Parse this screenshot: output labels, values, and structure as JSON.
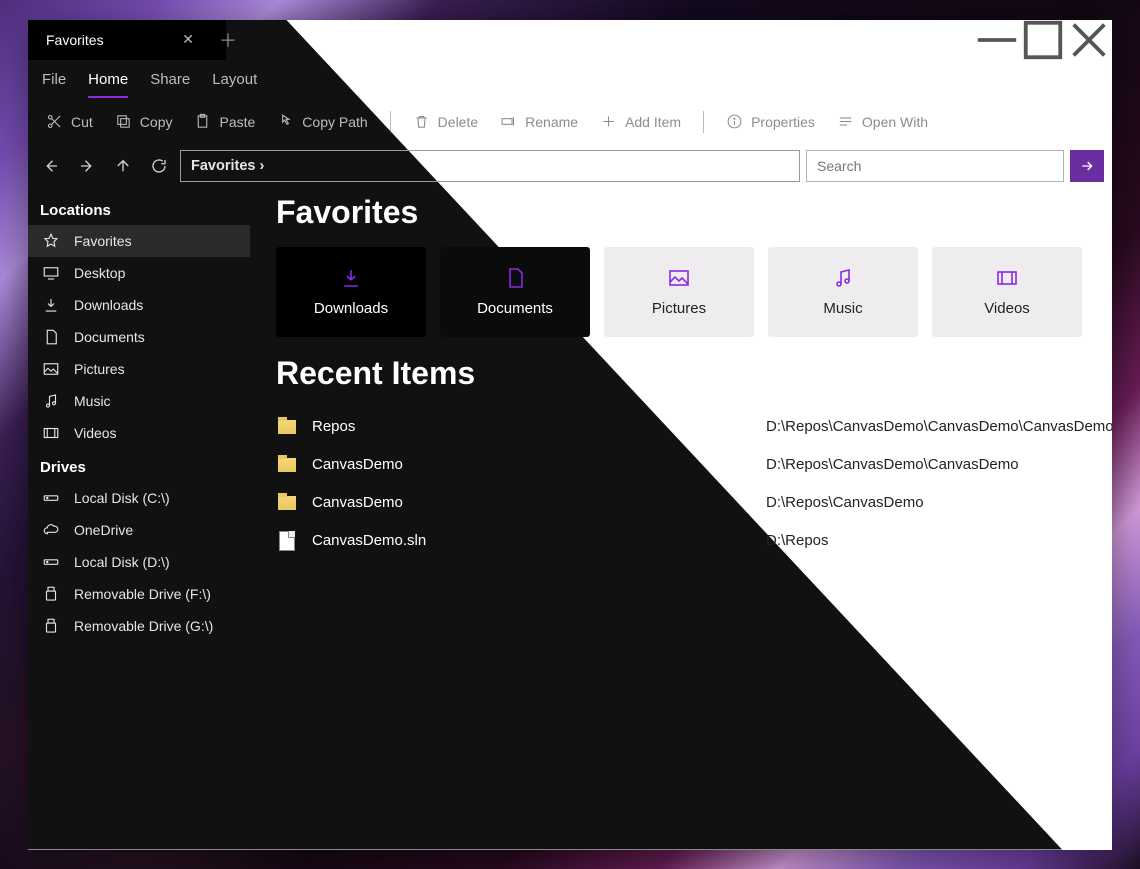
{
  "titlebar": {
    "tab_title": "Favorites"
  },
  "ribbon_tabs": [
    "File",
    "Home",
    "Share",
    "Layout"
  ],
  "ribbon_active": 1,
  "toolbar": {
    "cut": "Cut",
    "copy": "Copy",
    "paste": "Paste",
    "copy_path": "Copy Path",
    "delete": "Delete",
    "rename": "Rename",
    "add_item": "Add Item",
    "properties": "Properties",
    "open_with": "Open With"
  },
  "address": "Favorites ›",
  "search_placeholder": "Search",
  "sidebar": {
    "locations_heading": "Locations",
    "locations": [
      {
        "icon": "star",
        "label": "Favorites",
        "selected": true
      },
      {
        "icon": "monitor",
        "label": "Desktop"
      },
      {
        "icon": "download",
        "label": "Downloads"
      },
      {
        "icon": "doc",
        "label": "Documents"
      },
      {
        "icon": "image",
        "label": "Pictures"
      },
      {
        "icon": "music",
        "label": "Music"
      },
      {
        "icon": "video",
        "label": "Videos"
      }
    ],
    "drives_heading": "Drives",
    "drives": [
      {
        "icon": "drive",
        "label": "Local Disk (C:\\)"
      },
      {
        "icon": "cloud",
        "label": "OneDrive"
      },
      {
        "icon": "drive",
        "label": "Local Disk (D:\\)"
      },
      {
        "icon": "usb",
        "label": "Removable Drive (F:\\)"
      },
      {
        "icon": "usb",
        "label": "Removable Drive (G:\\)"
      }
    ]
  },
  "main": {
    "favorites_heading": "Favorites",
    "tiles": [
      {
        "icon": "download",
        "label": "Downloads",
        "theme": "dark"
      },
      {
        "icon": "doc",
        "label": "Documents",
        "theme": "darkish"
      },
      {
        "icon": "image",
        "label": "Pictures",
        "theme": "light"
      },
      {
        "icon": "music",
        "label": "Music",
        "theme": "light"
      },
      {
        "icon": "video",
        "label": "Videos",
        "theme": "light"
      }
    ],
    "recent_heading": "Recent Items",
    "recents": [
      {
        "icon": "folder",
        "name": "Repos",
        "path": "D:\\Repos\\CanvasDemo\\CanvasDemo\\CanvasDemo."
      },
      {
        "icon": "folder",
        "name": "CanvasDemo",
        "path": "D:\\Repos\\CanvasDemo\\CanvasDemo"
      },
      {
        "icon": "folder",
        "name": "CanvasDemo",
        "path": "D:\\Repos\\CanvasDemo"
      },
      {
        "icon": "file",
        "name": "CanvasDemo.sln",
        "path": "D:\\Repos"
      }
    ]
  }
}
